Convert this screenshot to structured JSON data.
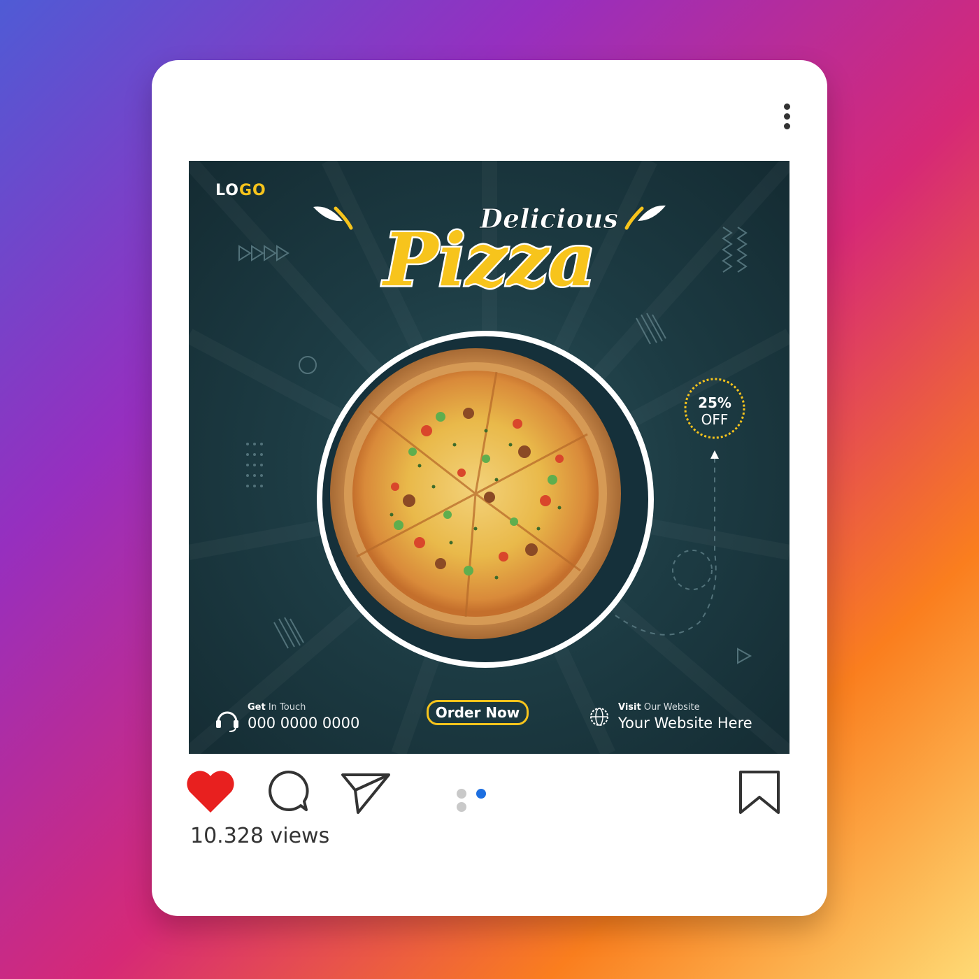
{
  "post": {
    "logo_prefix": "LO",
    "logo_suffix": "GO",
    "title_script": "Delicious",
    "title_main": "Pizza",
    "discount_value": "25%",
    "discount_label": "OFF",
    "contact_label_bold": "Get",
    "contact_label_rest": " In Touch",
    "contact_phone": "000 0000 0000",
    "order_button": "Order Now",
    "website_label_bold": "Visit",
    "website_label_rest": " Our Website",
    "website_value": "Your Website Here"
  },
  "actions": {
    "icons": [
      "heart-icon",
      "comment-icon",
      "send-icon",
      "bookmark-icon"
    ],
    "liked": true,
    "carousel_active_index": 1,
    "carousel_count": 3
  },
  "stats": {
    "views": "10.328 views"
  },
  "colors": {
    "accent_yellow": "#f7c41c",
    "post_background": "#1d3c44",
    "heart_red": "#e8201f",
    "carousel_active": "#1d6fe0"
  }
}
